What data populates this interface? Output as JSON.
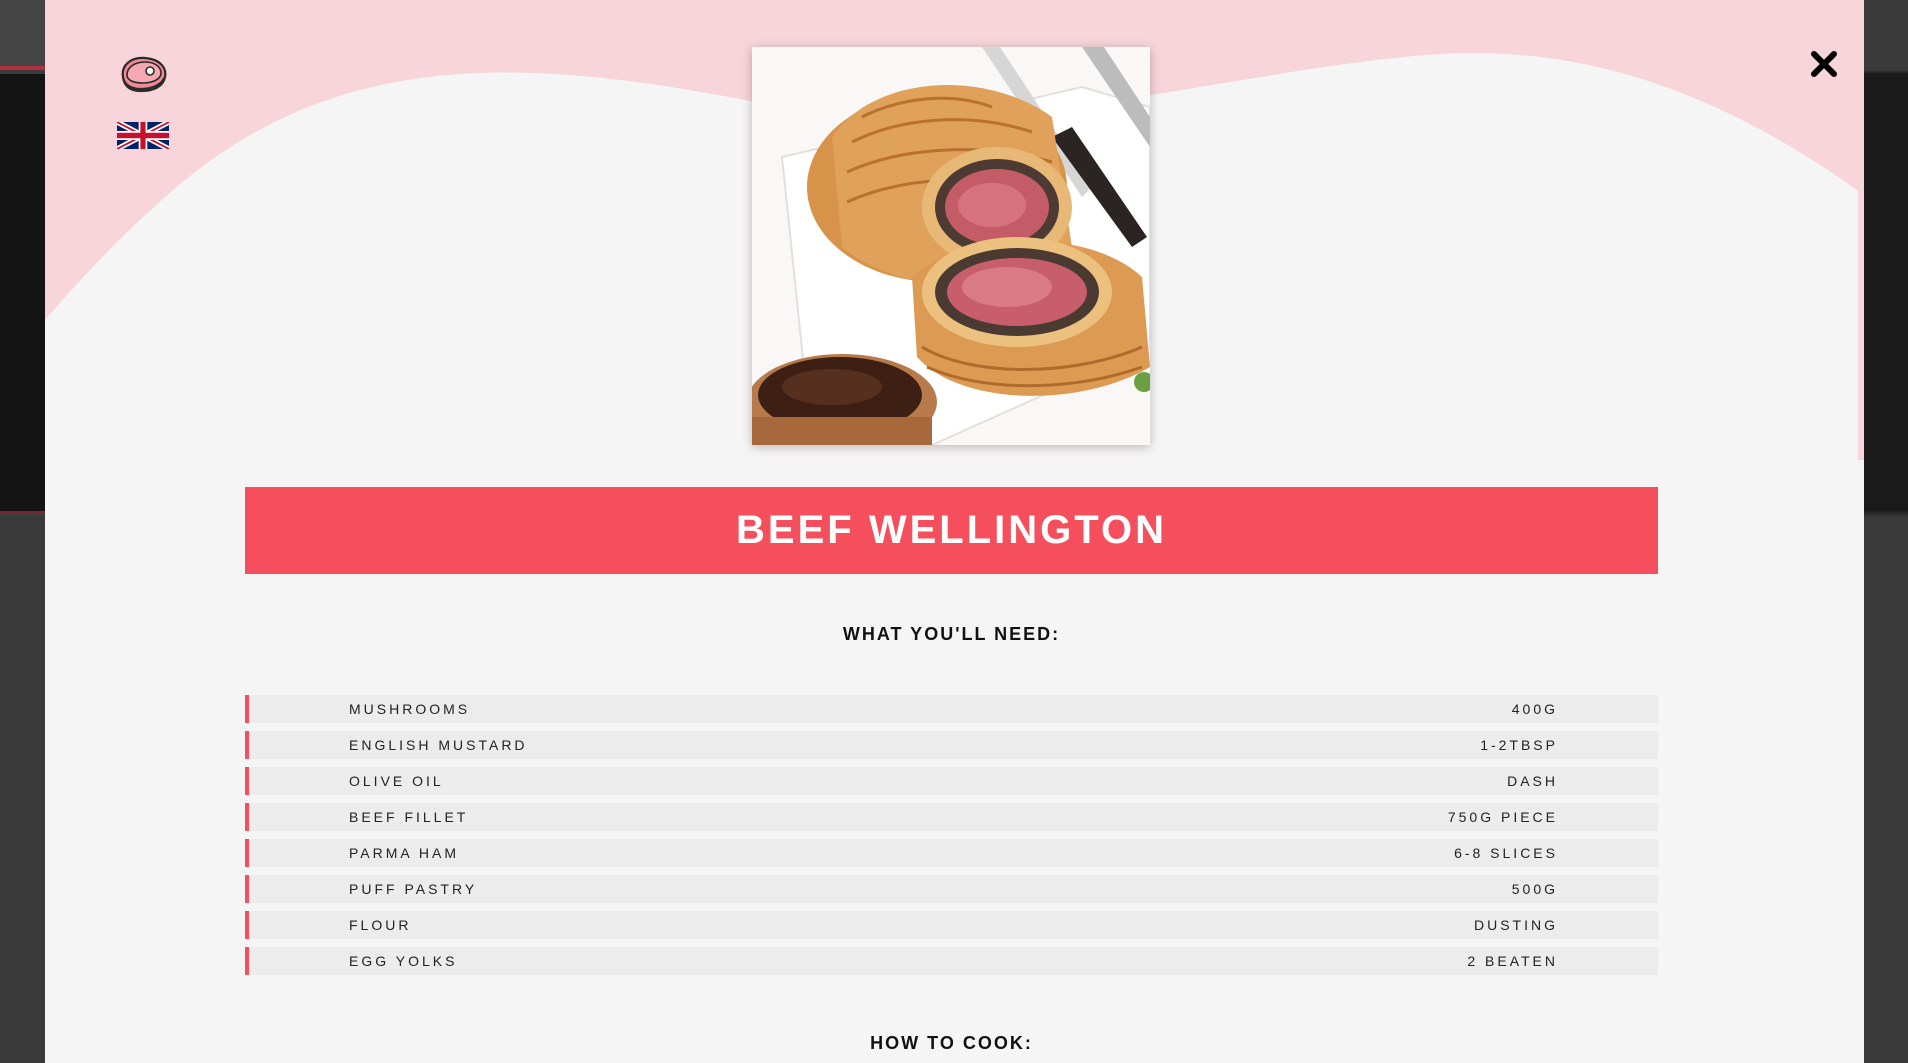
{
  "recipe": {
    "title": "BEEF WELLINGTON",
    "needs_heading": "WHAT YOU'LL NEED:",
    "cook_heading": "HOW TO COOK:",
    "ingredients": [
      {
        "name": "MUSHROOMS",
        "amount": "400G"
      },
      {
        "name": "ENGLISH MUSTARD",
        "amount": "1-2TBSP"
      },
      {
        "name": "OLIVE OIL",
        "amount": "DASH"
      },
      {
        "name": "BEEF FILLET",
        "amount": "750G PIECE"
      },
      {
        "name": "PARMA HAM",
        "amount": "6-8 SLICES"
      },
      {
        "name": "PUFF PASTRY",
        "amount": "500G"
      },
      {
        "name": "FLOUR",
        "amount": "DUSTING"
      },
      {
        "name": "EGG YOLKS",
        "amount": "2 BEATEN"
      }
    ]
  },
  "icons": {
    "brand": "steak-icon",
    "language": "uk-flag-icon",
    "close": "close-icon"
  },
  "colors": {
    "accent": "#f54e5c",
    "wave": "#f7d5da",
    "modal_bg": "#f6f5f5",
    "row_bg": "#ececec"
  }
}
